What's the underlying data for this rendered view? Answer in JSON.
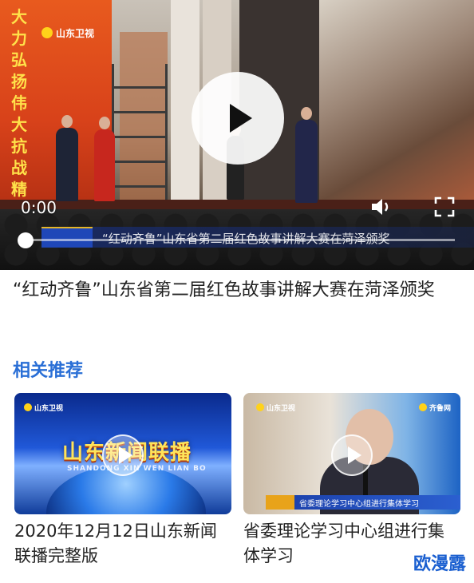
{
  "player": {
    "banner_text": "大力弘扬伟大抗战精神",
    "station_logo": "山东卫视",
    "current_time": "0:00",
    "caption_text": "“红动齐鲁”山东省第二届红色故事讲解大赛在菏泽颁奖",
    "progress": 0,
    "icons": {
      "play": "play-icon",
      "volume": "volume-icon",
      "fullscreen": "fullscreen-icon"
    }
  },
  "video": {
    "title": "“红动齐鲁”山东省第二届红色故事讲解大赛在菏泽颁奖"
  },
  "related": {
    "heading": "相关推荐",
    "accent_color": "#2a6fd6",
    "items": [
      {
        "title": "2020年12月12日山东新闻联播完整版",
        "thumb_logo": "山东卫视",
        "thumb_title": "山东新闻联播",
        "thumb_subtitle": "SHANDONG XIN WEN LIAN BO"
      },
      {
        "title": "省委理论学习中心组进行集体学习",
        "thumb_logo": "山东卫视",
        "thumb_logo_right": "齐鲁网",
        "lower_third": "省委理论学习中心组进行集体学习"
      }
    ]
  },
  "watermark": "欧漫露"
}
